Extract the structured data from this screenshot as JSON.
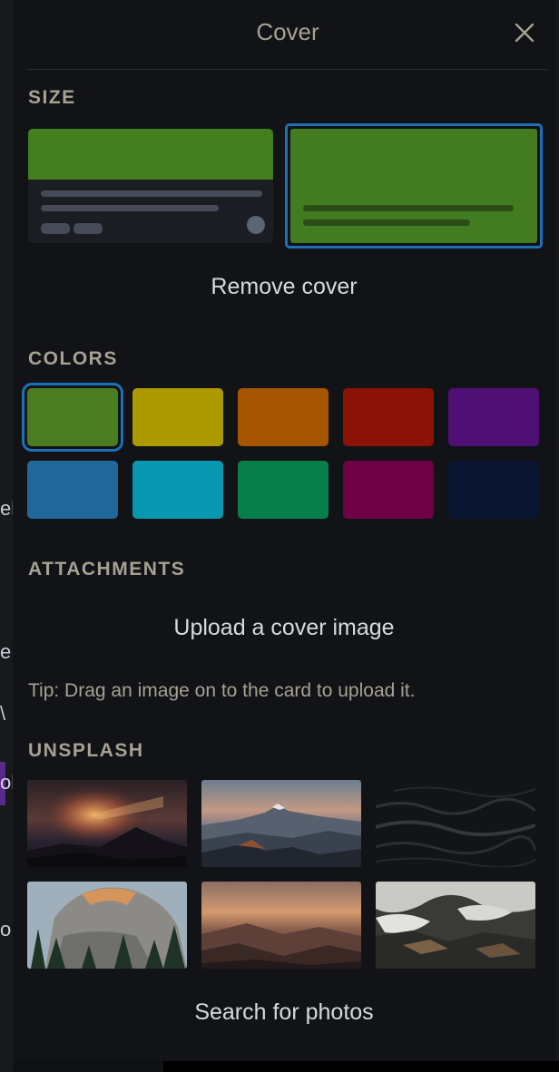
{
  "background": {
    "left_fragments": [
      "el",
      "e",
      "\\",
      "ol",
      "o"
    ]
  },
  "panel": {
    "title": "Cover",
    "close_icon": "close-icon",
    "size": {
      "label": "SIZE",
      "selected": "full",
      "remove_label": "Remove cover"
    },
    "colors": {
      "label": "COLORS",
      "selected_index": 0,
      "swatches": [
        {
          "name": "green",
          "hex": "#4a7c21"
        },
        {
          "name": "yellow",
          "hex": "#ad9a00"
        },
        {
          "name": "orange",
          "hex": "#a65500"
        },
        {
          "name": "red",
          "hex": "#8c1208"
        },
        {
          "name": "purple",
          "hex": "#500f74"
        },
        {
          "name": "blue",
          "hex": "#216799"
        },
        {
          "name": "sky",
          "hex": "#0797b0"
        },
        {
          "name": "lime",
          "hex": "#087f4a"
        },
        {
          "name": "pink",
          "hex": "#700045"
        },
        {
          "name": "black",
          "hex": "#0a1631"
        }
      ]
    },
    "attachments": {
      "label": "ATTACHMENTS",
      "upload_label": "Upload a cover image",
      "tip": "Tip: Drag an image on to the card to upload it."
    },
    "unsplash": {
      "label": "UNSPLASH",
      "photos": [
        "sunset-mountain-rays",
        "dusk-mountain-range",
        "dark-water",
        "granite-dome-pines",
        "desert-dusk-hills",
        "snowy-mountain-clouds"
      ],
      "search_label": "Search for photos"
    },
    "accent_color": "#1d6fb8"
  }
}
